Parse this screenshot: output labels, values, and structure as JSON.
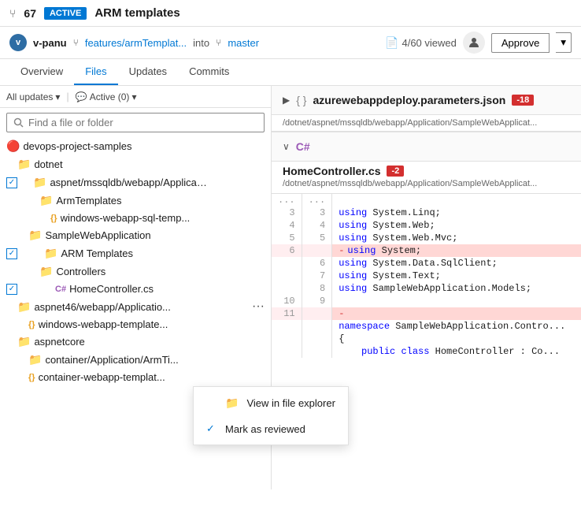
{
  "topBar": {
    "prIcon": "⑂",
    "prCount": "67",
    "activeBadge": "ACTIVE",
    "prTitle": "ARM templates"
  },
  "authorBar": {
    "avatarInitial": "v",
    "authorName": "v-panu",
    "branchIcon": "⑂",
    "branchName": "features/armTemplat...",
    "intoText": "into",
    "masterIcon": "⑂",
    "masterName": "master",
    "viewedText": "4/60 viewed",
    "approveLabel": "Approve"
  },
  "navTabs": {
    "tabs": [
      "Overview",
      "Files",
      "Updates",
      "Commits"
    ],
    "activeTab": "Files"
  },
  "filterBar": {
    "allUpdates": "All updates",
    "activeFilter": "Active (0)"
  },
  "searchPlaceholder": "Find a file or folder",
  "fileTree": {
    "root": "devops-project-samples",
    "items": [
      {
        "indent": 1,
        "type": "folder",
        "name": "dotnet"
      },
      {
        "indent": 2,
        "type": "folder",
        "name": "aspnet/mssqldb/webapp/Applicati...",
        "checked": true
      },
      {
        "indent": 3,
        "type": "folder",
        "name": "ArmTemplates"
      },
      {
        "indent": 4,
        "type": "json",
        "name": "windows-webapp-sql-temp..."
      },
      {
        "indent": 3,
        "type": "folder",
        "name": "SampleWebApplication"
      },
      {
        "indent": 4,
        "type": "folder",
        "name": "ARM Templates",
        "checked": true
      },
      {
        "indent": 4,
        "type": "folder",
        "name": "Controllers"
      },
      {
        "indent": 5,
        "type": "cs",
        "name": "HomeController.cs",
        "checked": true
      },
      {
        "indent": 2,
        "type": "folder",
        "name": "aspnet46/webapp/Applicatio...",
        "hasDots": true
      },
      {
        "indent": 3,
        "type": "json",
        "name": "windows-webapp-template..."
      },
      {
        "indent": 2,
        "type": "folder",
        "name": "aspnetcore"
      },
      {
        "indent": 3,
        "type": "folder",
        "name": "container/Application/ArmTi..."
      },
      {
        "indent": 3,
        "type": "json",
        "name": "container-webapp-templat..."
      }
    ]
  },
  "contextMenu": {
    "items": [
      {
        "icon": "📁",
        "label": "View in file explorer",
        "checked": false
      },
      {
        "icon": "✓",
        "label": "Mark as reviewed",
        "checked": true
      }
    ]
  },
  "rightPanel": {
    "sections": [
      {
        "type": "json",
        "arrow": ">",
        "icon": "{}",
        "name": "azurewebappdeploy.parameters.json",
        "diffBadge": "-18",
        "path": "/dotnet/aspnet/mssqldb/webapp/Application/SampleWebApplicat..."
      },
      {
        "type": "cs",
        "arrow": "∨",
        "lang": "C#",
        "name": "HomeController.cs",
        "diffBadge": "-2",
        "path": "/dotnet/aspnet/mssqldb/webapp/Application/SampleWebApplicat...",
        "codeLines": [
          {
            "left": "...",
            "right": "...",
            "content": ""
          },
          {
            "left": "3",
            "right": "3",
            "content": "    using System.Linq;"
          },
          {
            "left": "4",
            "right": "4",
            "content": "    using System.Web;"
          },
          {
            "left": "5",
            "right": "5",
            "content": "    using System.Web.Mvc;"
          },
          {
            "left": "6",
            "right": "",
            "content": "    using System;",
            "removed": true
          },
          {
            "left": "",
            "right": "6",
            "content": "    using System.Data.SqlClient;"
          },
          {
            "left": "",
            "right": "7",
            "content": "    using System.Text;"
          },
          {
            "left": "",
            "right": "8",
            "content": "    using SampleWebApplication.Models;"
          },
          {
            "left": "10",
            "right": "9",
            "content": ""
          },
          {
            "left": "11",
            "right": "",
            "content": "",
            "removed": true
          },
          {
            "left": "",
            "right": "",
            "content": "namespace SampleWebApplication.Contro..."
          },
          {
            "left": "",
            "right": "",
            "content": "{"
          },
          {
            "left": "",
            "right": "",
            "content": "    public class HomeController : Co..."
          }
        ]
      }
    ]
  }
}
